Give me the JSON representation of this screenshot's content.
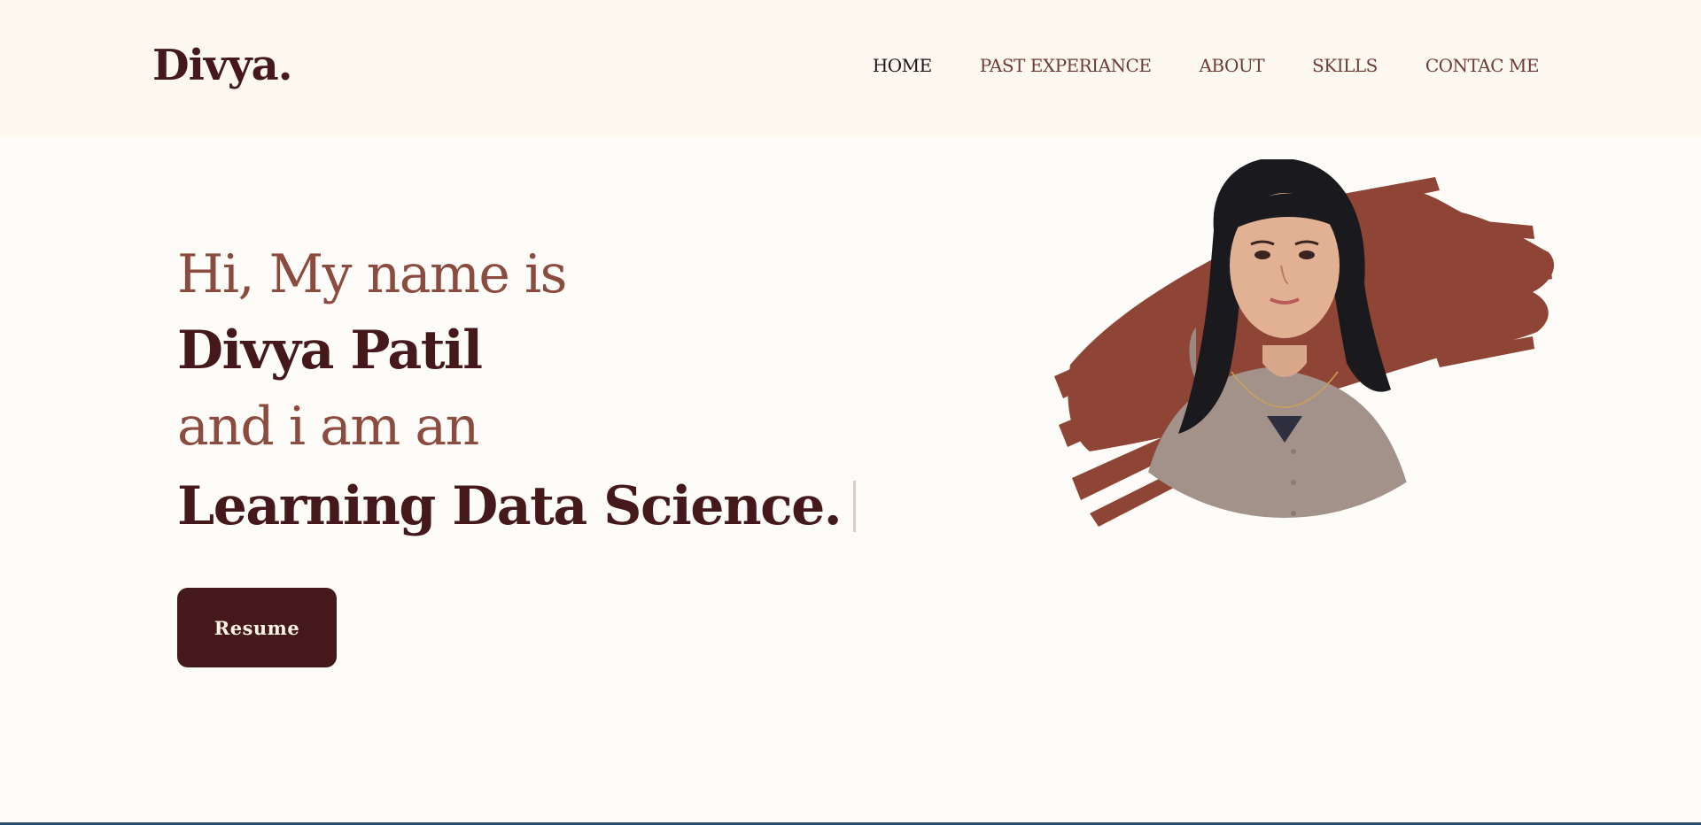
{
  "logo": "Divya.",
  "nav": {
    "items": [
      {
        "label": "HOME",
        "active": true
      },
      {
        "label": "PAST EXPERIANCE"
      },
      {
        "label": "ABOUT"
      },
      {
        "label": "SKILLS"
      },
      {
        "label": "CONTAC ME"
      }
    ]
  },
  "hero": {
    "line1": "Hi, My name is",
    "line2": "Divya Patil",
    "line3": "and i am an",
    "line4": "Learning Data Science."
  },
  "resume_button": "Resume",
  "colors": {
    "nav_background": "#fdf9f1",
    "page_background": "#fdfcf9",
    "primary_dark": "#45191b",
    "accent_brown": "#8b4b3e",
    "brush_stroke": "#8e4536",
    "nav_link": "#6e3b34",
    "nav_link_active": "#22111a"
  },
  "icons": {
    "photo": "profile-photo-with-brush-stroke"
  }
}
